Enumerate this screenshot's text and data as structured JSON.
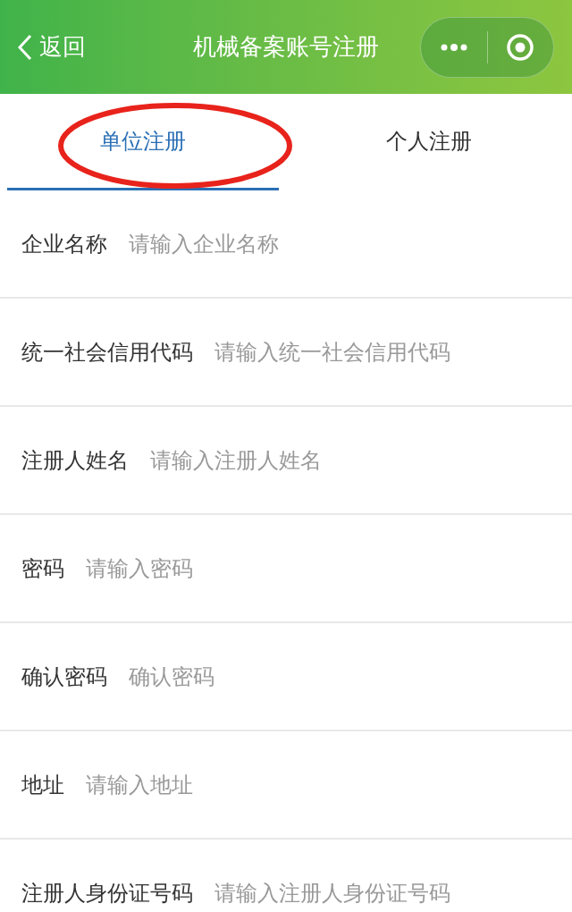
{
  "header": {
    "back": "返回",
    "title": "机械备案账号注册"
  },
  "tabs": [
    {
      "label": "单位注册",
      "selected": true
    },
    {
      "label": "个人注册",
      "selected": false
    }
  ],
  "form": [
    {
      "label": "企业名称",
      "placeholder": "请输入企业名称"
    },
    {
      "label": "统一社会信用代码",
      "placeholder": "请输入统一社会信用代码"
    },
    {
      "label": "注册人姓名",
      "placeholder": "请输入注册人姓名"
    },
    {
      "label": "密码",
      "placeholder": "请输入密码"
    },
    {
      "label": "确认密码",
      "placeholder": "确认密码"
    },
    {
      "label": "地址",
      "placeholder": "请输入地址"
    },
    {
      "label": "注册人身份证号码",
      "placeholder": "请输入注册人身份证号码"
    }
  ]
}
